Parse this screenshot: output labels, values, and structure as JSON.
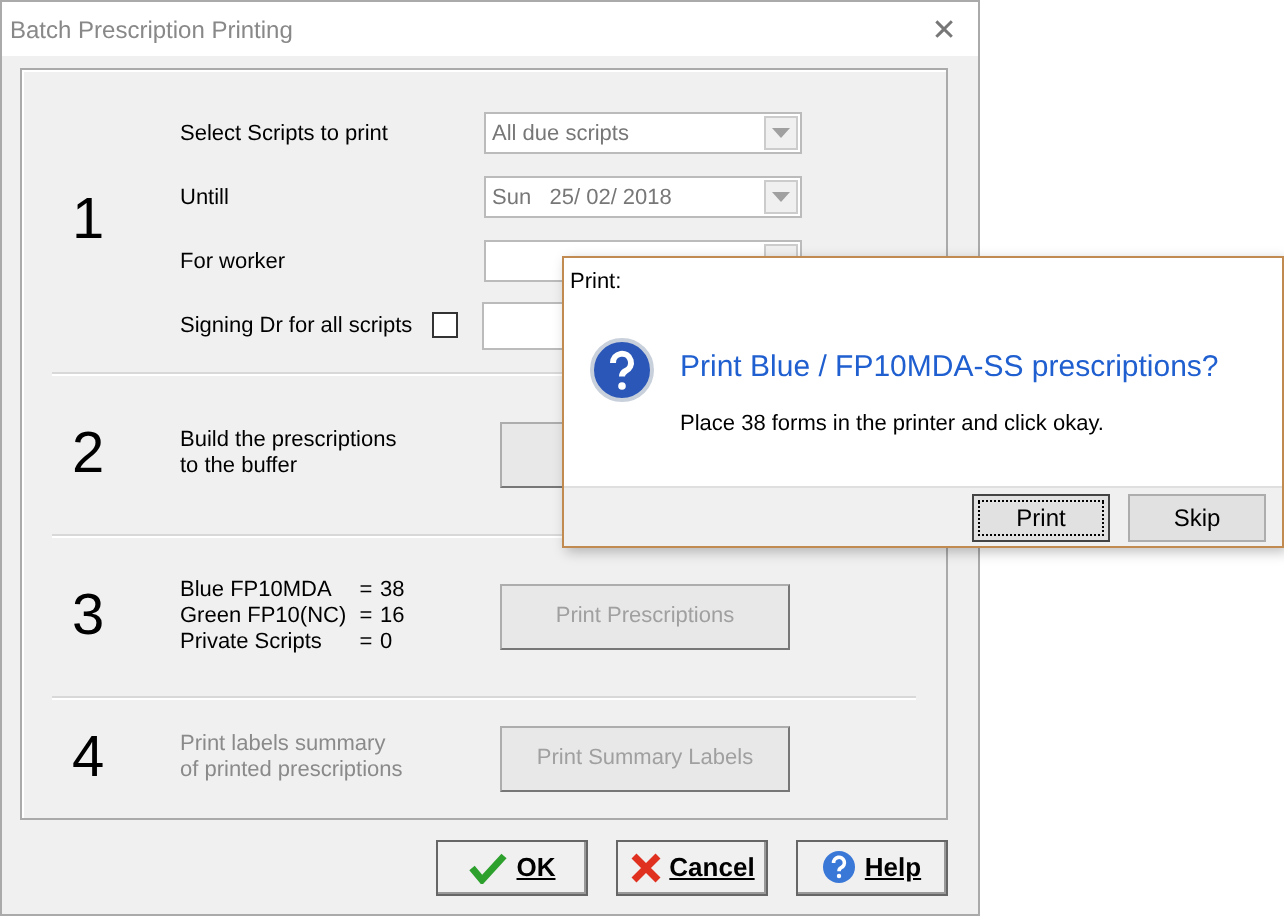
{
  "window": {
    "title": "Batch Prescription Printing",
    "close": "✕"
  },
  "step1": {
    "number": "1",
    "fields": [
      {
        "label": "Select Scripts to print",
        "value": "All due scripts",
        "kind": "combo",
        "disabled": true
      },
      {
        "label": "Untill",
        "value": "Sun   25/ 02/ 2018",
        "kind": "combo",
        "disabled": true
      },
      {
        "label": "For worker",
        "kind": "combo"
      },
      {
        "label": "Signing Dr for all scripts",
        "kind": "checkfield",
        "checked": false
      }
    ]
  },
  "step2": {
    "number": "2",
    "text": [
      "Build the prescriptions",
      "to the buffer"
    ]
  },
  "step3": {
    "number": "3",
    "counts": [
      {
        "label": "Blue FP10MDA",
        "separator": "=",
        "value": "38"
      },
      {
        "label": "Green FP10(NC)",
        "separator": "=",
        "value": "16"
      },
      {
        "label": "Private Scripts",
        "separator": "=",
        "value": "0"
      }
    ],
    "button": {
      "label": "Print Prescriptions",
      "disabled": true
    }
  },
  "step4": {
    "number": "4",
    "text": [
      "Print labels summary",
      "of printed prescriptions"
    ],
    "disabled": true,
    "button": {
      "label": "Print Summary Labels",
      "disabled": true
    }
  },
  "buttons": [
    {
      "label": "OK",
      "kind": "ok"
    },
    {
      "label": "Cancel",
      "kind": "cancel"
    },
    {
      "label": "Help",
      "kind": "help"
    }
  ],
  "message_box": {
    "title": "Print:",
    "heading": "Print Blue / FP10MDA-SS prescriptions?",
    "body": "Place 38 forms in the printer and click okay.",
    "buttons": [
      {
        "label": "Print",
        "focused": true
      },
      {
        "label": "Skip",
        "focused": false
      }
    ]
  }
}
